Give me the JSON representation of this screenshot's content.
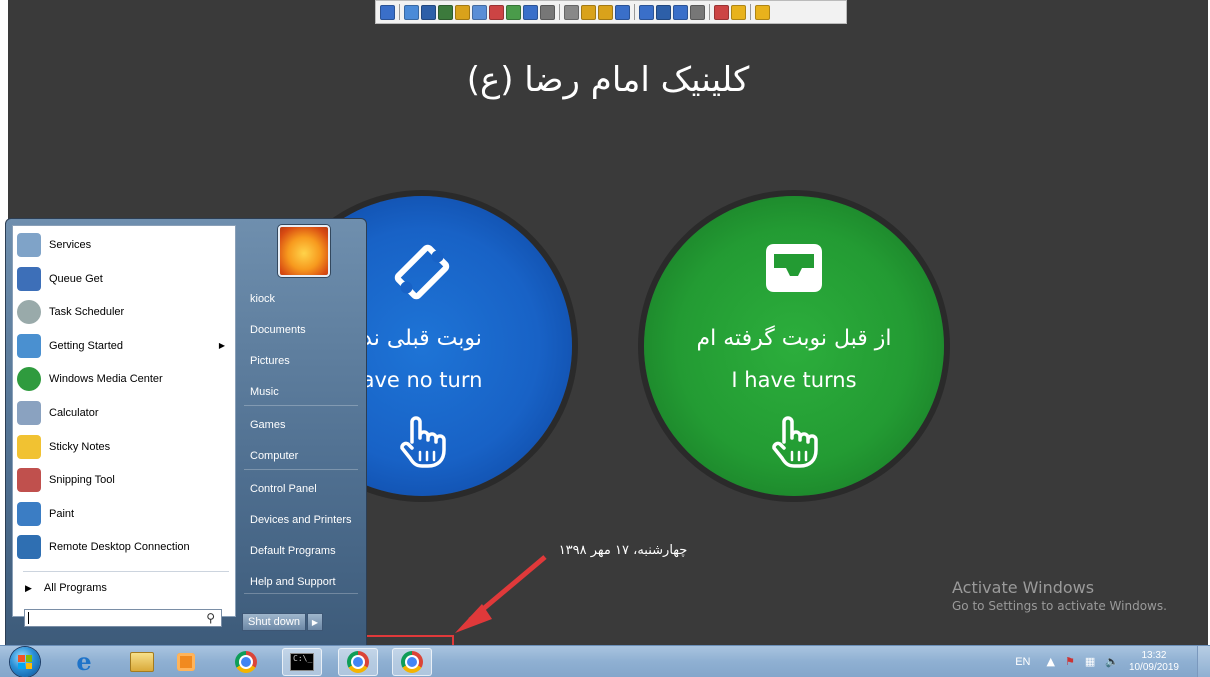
{
  "kiosk": {
    "title": "کلینیک امام رضا (ع)",
    "left_button": {
      "fa": "نوبت قبلی ند",
      "en": "ave no turn"
    },
    "right_button": {
      "fa": "از قبل نوبت گرفته ام",
      "en": "I have turns"
    },
    "date": "چهارشنبه، ۱۷ مهر ۱۳۹۸",
    "background": "#3a3a3a",
    "left_color": "#1862c6",
    "right_color": "#239b33"
  },
  "activation": {
    "title": "Activate Windows",
    "subtitle": "Go to Settings to activate Windows."
  },
  "toolbar": {
    "icons": [
      "pin-icon",
      "save-icon",
      "monitor-icon",
      "terminal-icon",
      "transfer-icon",
      "gear-icon",
      "people-icon",
      "phone-icon",
      "chat-icon",
      "user-icon",
      "users-icon",
      "lock-icon",
      "lock-icon",
      "window-icon",
      "fullscreen-icon",
      "screen-icon",
      "display-icon",
      "clipboard-icon",
      "tools-icon",
      "notes-icon",
      "close-icon"
    ]
  },
  "start_menu": {
    "programs": [
      {
        "label": "Services",
        "icon": "gear-icon"
      },
      {
        "label": "Queue Get",
        "icon": "snowflake-icon"
      },
      {
        "label": "Task Scheduler",
        "icon": "clock-icon"
      },
      {
        "label": "Getting Started",
        "icon": "document-icon",
        "has_submenu": true
      },
      {
        "label": "Windows Media Center",
        "icon": "windows-orb-icon"
      },
      {
        "label": "Calculator",
        "icon": "calculator-icon"
      },
      {
        "label": "Sticky Notes",
        "icon": "sticky-notes-icon"
      },
      {
        "label": "Snipping Tool",
        "icon": "scissors-icon"
      },
      {
        "label": "Paint",
        "icon": "palette-icon"
      },
      {
        "label": "Remote Desktop Connection",
        "icon": "remote-desktop-icon"
      }
    ],
    "all_programs": "All Programs",
    "search_placeholder": "",
    "user": "kiock",
    "right_items": [
      "Documents",
      "Pictures",
      "Music",
      "Games",
      "Computer",
      "Control Panel",
      "Devices and Printers",
      "Default Programs",
      "Help and Support"
    ],
    "shutdown": "Shut down"
  },
  "taskbar": {
    "pinned": [
      "ie-icon",
      "explorer-icon",
      "media-player-icon",
      "chrome-icon",
      "cmd-icon",
      "chrome-icon",
      "chrome-icon"
    ],
    "lang": "EN",
    "time": "13:32",
    "date": "10/09/2019"
  }
}
